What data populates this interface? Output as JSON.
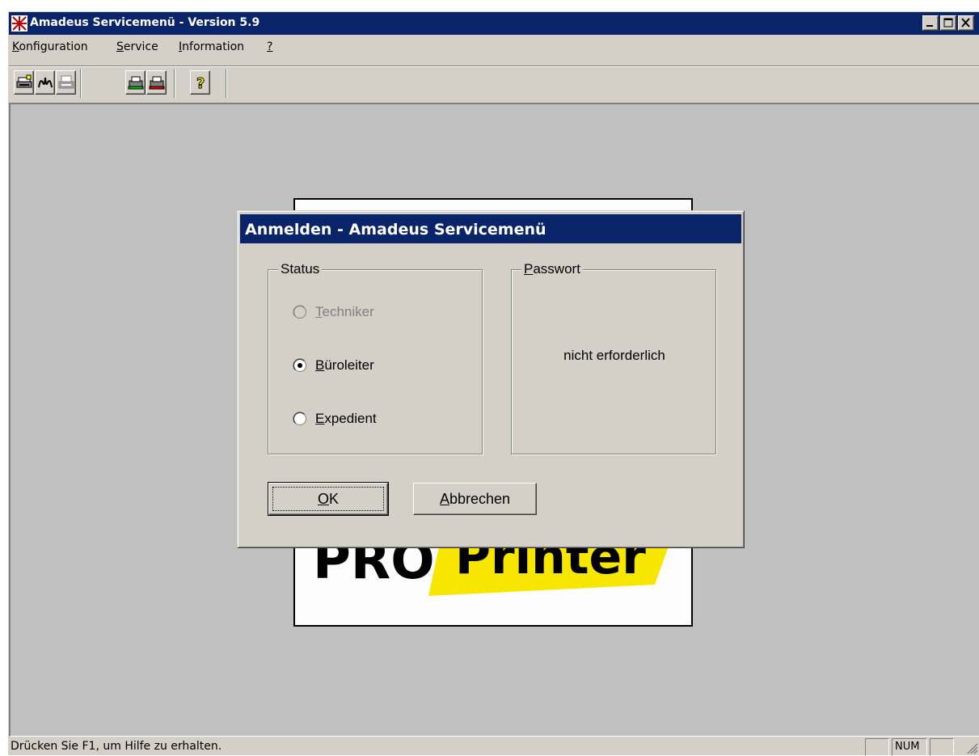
{
  "window": {
    "title": "Amadeus Servicemenü - Version 5.9",
    "controls": [
      "minimize-icon",
      "maximize-icon",
      "close-icon"
    ]
  },
  "menu": {
    "items": [
      {
        "label": "Konfiguration",
        "mnemonic": "K"
      },
      {
        "label": "Service",
        "mnemonic": "S"
      },
      {
        "label": "Information",
        "mnemonic": "I"
      },
      {
        "label": "?",
        "mnemonic": "?"
      }
    ]
  },
  "toolbar": {
    "buttons": [
      {
        "icon": "printer-configure-icon"
      },
      {
        "icon": "network-connect-icon"
      },
      {
        "icon": "print-icon"
      },
      {
        "icon": "service-green-icon"
      },
      {
        "icon": "service-red-icon"
      },
      {
        "icon": "help-icon"
      }
    ]
  },
  "splash": {
    "logo_text": "PRO Printer"
  },
  "dialog": {
    "title": "Anmelden - Amadeus Servicemenü",
    "status_group": {
      "label": "Status",
      "options": [
        {
          "label": "Techniker",
          "mnemonic": "T",
          "selected": false,
          "enabled": false
        },
        {
          "label": "Büroleiter",
          "mnemonic": "B",
          "selected": true,
          "enabled": true
        },
        {
          "label": "Expedient",
          "mnemonic": "E",
          "selected": false,
          "enabled": true
        }
      ]
    },
    "password_group": {
      "label": "Passwort",
      "mnemonic": "P",
      "text": "nicht erforderlich"
    },
    "ok_label": "OK",
    "cancel_label": "Abbrechen"
  },
  "statusbar": {
    "text": "Drücken Sie F1, um Hilfe zu erhalten.",
    "num_indicator": "NUM"
  },
  "colors": {
    "titlebar": "#0a246a",
    "face": "#d4d0c8",
    "client": "#c0c0c0",
    "logo_yellow": "#f7e600"
  }
}
